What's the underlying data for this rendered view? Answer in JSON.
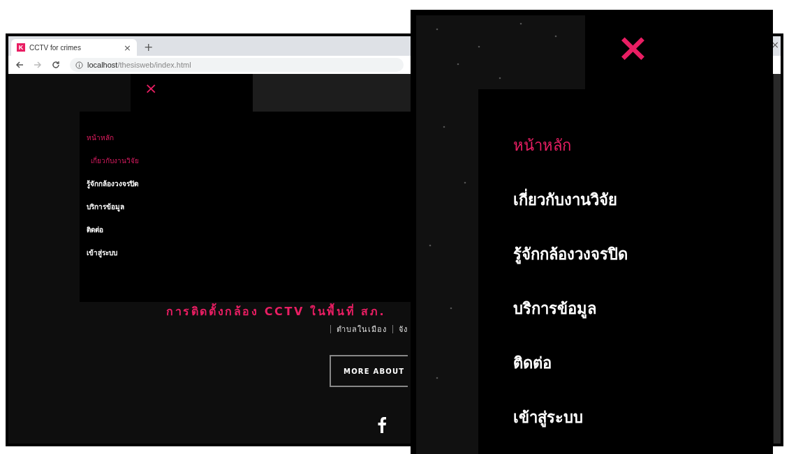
{
  "browser": {
    "tab": {
      "favicon": "K",
      "title": "CCTV for crimes",
      "close": "×"
    },
    "new_tab": "+",
    "url": {
      "host": "localhost",
      "path": "/thesisweb/index.html"
    },
    "side_close": "×"
  },
  "page": {
    "close_menu": "×",
    "menu": [
      {
        "label": "หน้าหลัก",
        "selected": true,
        "hovered": false
      },
      {
        "label": "เกี่ยวกับงานวิจัย",
        "selected": false,
        "hovered": true
      },
      {
        "label": "รู้จักกล้องวงจรปิด",
        "selected": false,
        "hovered": false
      },
      {
        "label": "บริการข้อมูล",
        "selected": false,
        "hovered": false
      },
      {
        "label": "ติดต่อ",
        "selected": false,
        "hovered": false
      },
      {
        "label": "เข้าสู่ระบบ",
        "selected": false,
        "hovered": false
      }
    ],
    "headline": "การติดตั้งกล้อง CCTV ในพื้นที่ สภ.",
    "subline": [
      "ตำบลในเมือง",
      "จัง"
    ],
    "button": "MORE ABOUT"
  },
  "zoom_panel": {
    "close_menu": "×",
    "menu": [
      {
        "label": "หน้าหลัก",
        "selected": true
      },
      {
        "label": "เกี่ยวกับงานวิจัย",
        "selected": false
      },
      {
        "label": "รู้จักกล้องวงจรปิด",
        "selected": false
      },
      {
        "label": "บริการข้อมูล",
        "selected": false
      },
      {
        "label": "ติดต่อ",
        "selected": false
      },
      {
        "label": "เข้าสู่ระบบ",
        "selected": false
      }
    ]
  }
}
